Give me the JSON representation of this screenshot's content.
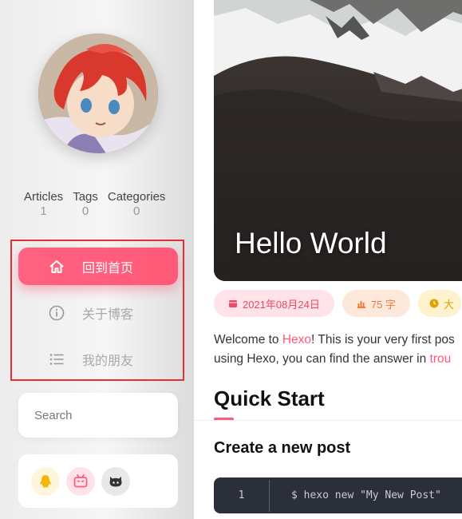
{
  "sidebar": {
    "stats": [
      {
        "label": "Articles",
        "count": "1"
      },
      {
        "label": "Tags",
        "count": "0"
      },
      {
        "label": "Categories",
        "count": "0"
      }
    ],
    "nav": [
      {
        "label": "回到首页",
        "icon": "home-icon",
        "active": true
      },
      {
        "label": "关于博客",
        "icon": "info-icon",
        "active": false
      },
      {
        "label": "我的朋友",
        "icon": "list-icon",
        "active": false
      }
    ],
    "search_placeholder": "Search",
    "social": [
      {
        "icon": "qq-icon",
        "color": "#f5b800"
      },
      {
        "icon": "bilibili-icon",
        "color": "#ff5a78"
      },
      {
        "icon": "github-icon",
        "color": "#333333"
      }
    ]
  },
  "post": {
    "title": "Hello World",
    "date": "2021年08月24日",
    "words": "75 字",
    "extra_badge": "大",
    "intro": {
      "p1": "Welcome to ",
      "link1": "Hexo",
      "p2": "! This is your very first pos",
      "p3": "using Hexo, you can find the answer in ",
      "link2": "trou"
    },
    "h2": "Quick Start",
    "h3": "Create a new post",
    "code": {
      "line": "1",
      "text": "$ hexo new \"My New Post\""
    }
  },
  "colors": {
    "accent": "#ff5a78",
    "highlight_box": "#e62e36"
  }
}
